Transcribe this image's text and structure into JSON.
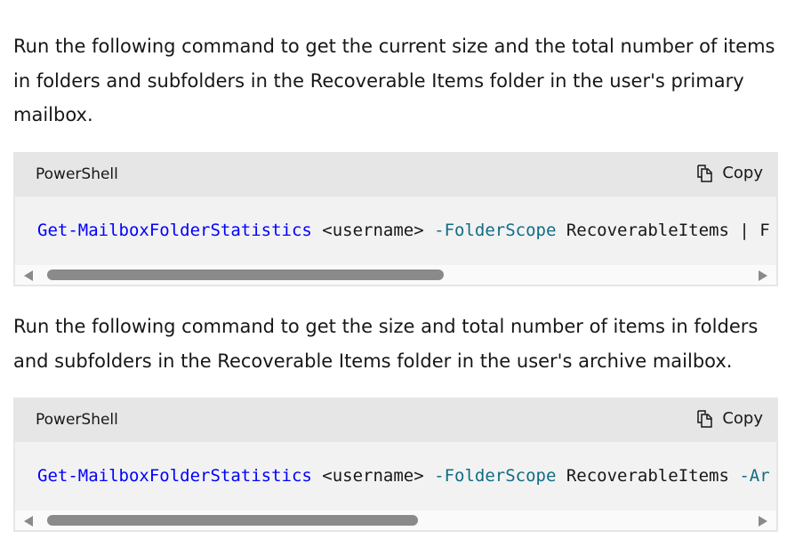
{
  "paragraphs": [
    "Run the following command to get the current size and the total number of items in folders and subfolders in the Recoverable Items folder in the user's primary mailbox.",
    "Run the following command to get the size and total number of items in folders and subfolders in the Recoverable Items folder in the user's archive mailbox."
  ],
  "code_blocks": [
    {
      "language": "PowerShell",
      "copy_label": "Copy",
      "copy_icon": "copy-icon",
      "tokens": {
        "cmd": "Get-MailboxFolderStatistics",
        "arg": " <username> ",
        "param": "-FolderScope",
        "value": " RecoverableItems ",
        "rest": "| F"
      },
      "scroll_fraction": 0.55
    },
    {
      "language": "PowerShell",
      "copy_label": "Copy",
      "copy_icon": "copy-icon",
      "tokens": {
        "cmd": "Get-MailboxFolderStatistics",
        "arg": " <username> ",
        "param": "-FolderScope",
        "value": " RecoverableItems ",
        "rest": "-Ar"
      },
      "scroll_fraction": 0.52
    }
  ]
}
